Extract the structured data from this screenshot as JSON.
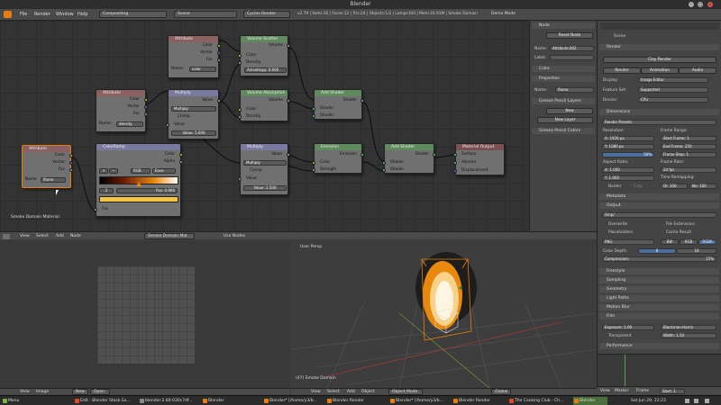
{
  "window": {
    "title": "Blender"
  },
  "info": {
    "menus": [
      "File",
      "Render",
      "Window",
      "Help"
    ],
    "screen": "Compositing",
    "scene": "Scene",
    "engine": "Cycles Render",
    "stats": "v2.79 | Verts:16 | Faces:12 | Tris:24 | Objects:1/2 | Lamps:0/0 | Mem:16.91M | Smoke Domain",
    "demo": "Demo Mode"
  },
  "nodes": {
    "attr_top": {
      "title": "Attribute",
      "outs": [
        "Color",
        "Vector",
        "Fac"
      ],
      "name_label": "Name:",
      "name_val": "color"
    },
    "vol_scatter": {
      "title": "Volume Scatter",
      "out": "Volume",
      "ins": [
        "Color",
        "Density",
        "Anisotropy: 0.000"
      ]
    },
    "attr_mid": {
      "title": "Attribute",
      "outs": [
        "Color",
        "Vector",
        "Fac"
      ],
      "name_label": "Name:",
      "name_val": "density"
    },
    "multiply1": {
      "title": "Multiply",
      "out": "Value",
      "op": "Multiply",
      "clamp": "Clamp",
      "in": "Value",
      "val": "Value: 5.000"
    },
    "vol_abs": {
      "title": "Volume Absorption",
      "out": "Volume",
      "ins": [
        "Color",
        "Density"
      ]
    },
    "add_shader1": {
      "title": "Add Shader",
      "out": "Shader",
      "ins": [
        "Shader",
        "Shader"
      ]
    },
    "attr_flame": {
      "title": "Attribute",
      "outs": [
        "Color",
        "Vector",
        "Fac"
      ],
      "name_label": "Name",
      "name_val": "flame"
    },
    "colorramp": {
      "title": "ColorRamp",
      "outs": [
        "Color",
        "Alpha"
      ],
      "mode": "RGB",
      "interp": "Ease",
      "stop": "2",
      "pos": "Pos: 0.900",
      "fac": "Fac"
    },
    "multiply2": {
      "title": "Multiply",
      "out": "Value",
      "op": "Multiply",
      "clamp": "Clamp",
      "in": "Value",
      "val": "Value: 2.500"
    },
    "emission": {
      "title": "Emission",
      "out": "Emission",
      "ins": [
        "Color",
        "Strength"
      ]
    },
    "add_shader2": {
      "title": "Add Shader",
      "out": "Shader",
      "ins": [
        "Shader",
        "Shader"
      ]
    },
    "mat_out": {
      "title": "Material Output",
      "ins": [
        "Surface",
        "Volume",
        "Displacement"
      ]
    }
  },
  "node_editor": {
    "material_label": "Smoke Domain Material",
    "header": {
      "menus": [
        "View",
        "Select",
        "Add",
        "Node"
      ],
      "material": "Smoke Domain Mat",
      "use_nodes": "Use Nodes"
    }
  },
  "props": {
    "node_header": "Node",
    "reset": "Reset Node",
    "name_label": "Name:",
    "name_val": "Attribute.002",
    "label_label": "Label:",
    "color_hdr": "Color",
    "properties_hdr": "Properties",
    "prop_name_label": "Name:",
    "prop_name_val": "flame",
    "gp_hdr": "Grease Pencil Layers",
    "new": "New",
    "new_layer": "New Layer",
    "gp_colors": "Grease Pencil Colors"
  },
  "render": {
    "scene": "Scene",
    "render_hdr": "Render",
    "clay": "Clay Render",
    "tabs": [
      "Render",
      "Animation",
      "Audio"
    ],
    "display_l": "Display:",
    "display": "Image Editor",
    "featureset_l": "Feature Set:",
    "featureset": "Supported",
    "device_l": "Device:",
    "device": "CPU",
    "dimensions": "Dimensions",
    "presets": "Render Presets",
    "resolution": "Resolution:",
    "resx": "X: 1920 px",
    "resy": "Y: 1080 px",
    "respct": "50%",
    "framerange": "Frame Range:",
    "start": "Start Frame: 1",
    "end": "End Frame: 250",
    "step": "Frame Step: 1",
    "aspect": "Aspect Ratio:",
    "ax": "X: 1.000",
    "ay": "Y: 1.000",
    "framerate": "Frame Rate:",
    "fps": "24 fps",
    "remap": "Time Remapping:",
    "old": "Ol: 100",
    "new_r": "Ne: 100",
    "border": "Border",
    "crop": "Crop",
    "metadata": "Metadata",
    "output": "Output",
    "path": "/tmp/",
    "overwrite": "Overwrite",
    "fileext": "File Extensions",
    "placeholders": "Placeholders",
    "cache": "Cache Result",
    "format": "PNG",
    "bw": "BW",
    "rgb": "RGB",
    "rgba": "RGBA",
    "colordepth": "Color Depth:",
    "depth8": "8",
    "depth16": "16",
    "compression": "Compression:",
    "compval": "15%",
    "panels": [
      "Freestyle",
      "Sampling",
      "Geometry",
      "Light Paths",
      "Motion Blur",
      "Film"
    ],
    "exposure": "Exposure: 1.00",
    "filter": "Blackman-Harris",
    "transparent": "Transparent",
    "width": "Width: 1.50",
    "performance": "Performance"
  },
  "viewport": {
    "label": "User Persp",
    "object": "(47) Smoke Domain",
    "mode": "Object Mode",
    "orientation": "Global",
    "menus": [
      "View",
      "Select",
      "Add",
      "Object"
    ]
  },
  "uv": {
    "menus": [
      "View",
      "Image"
    ],
    "new": "New",
    "open": "Open"
  },
  "timeline": {
    "menus": [
      "View",
      "Marker",
      "Frame",
      "Playback"
    ],
    "start": "Start: 1"
  },
  "taskbar": {
    "items": [
      "Menu",
      "Edit - Blender Stack Ex...",
      "blender-2.80-030c7df...",
      "Blender",
      "Blender* [/home/y3/b...",
      "Blender Render",
      "Blender* [/home/y3/b...",
      "Blender Render",
      "The Cooking Club - Ch...",
      "Blender"
    ],
    "clock": "Sat Jun 29, 23:23"
  },
  "colors": {
    "accent": "#5680c2",
    "flame_orange": "#e8890e",
    "ramp_yellow": "#f5c542"
  }
}
